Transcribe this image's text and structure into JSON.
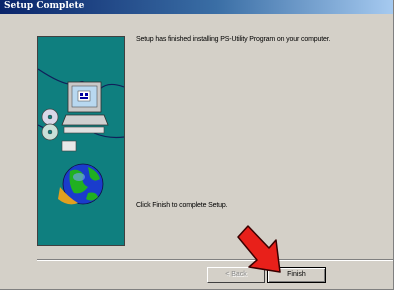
{
  "window": {
    "title": "Setup Complete"
  },
  "messages": {
    "installed": "Setup has finished installing PS-Utility Program on your computer.",
    "finish_hint": "Click Finish to complete Setup."
  },
  "buttons": {
    "back": "< Back",
    "finish": "Finish"
  },
  "colors": {
    "titlebar": "#0a246a",
    "panel": "#0f7f7f",
    "arrow": "#e8201a",
    "dialog": "#d4d0c8"
  },
  "icons": {
    "side_graphic": [
      "computer-icon",
      "cd-icon",
      "globe-icon"
    ],
    "annotation": "red-arrow-icon"
  }
}
